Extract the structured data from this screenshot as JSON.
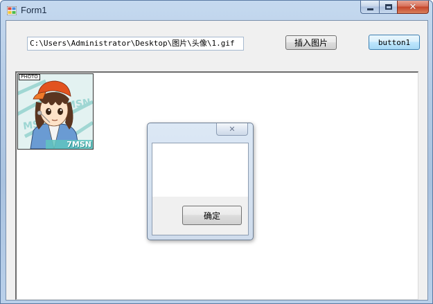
{
  "window": {
    "title": "Form1",
    "controls": {
      "minimize": "minimize",
      "maximize": "maximize",
      "close": "close"
    },
    "close_color": "#c5452a"
  },
  "form": {
    "path_value": "C:\\Users\\Administrator\\Desktop\\图片\\头像\\1.gif",
    "insert_button_label": "插入图片",
    "button1_label": "button1"
  },
  "image_panel": {
    "photo_label": "PHOTO",
    "brand_label": "7MSN",
    "image_icon": "cartoon-avatar-image"
  },
  "dialog": {
    "message": "",
    "ok_label": "确定",
    "close_icon": "close-icon"
  }
}
